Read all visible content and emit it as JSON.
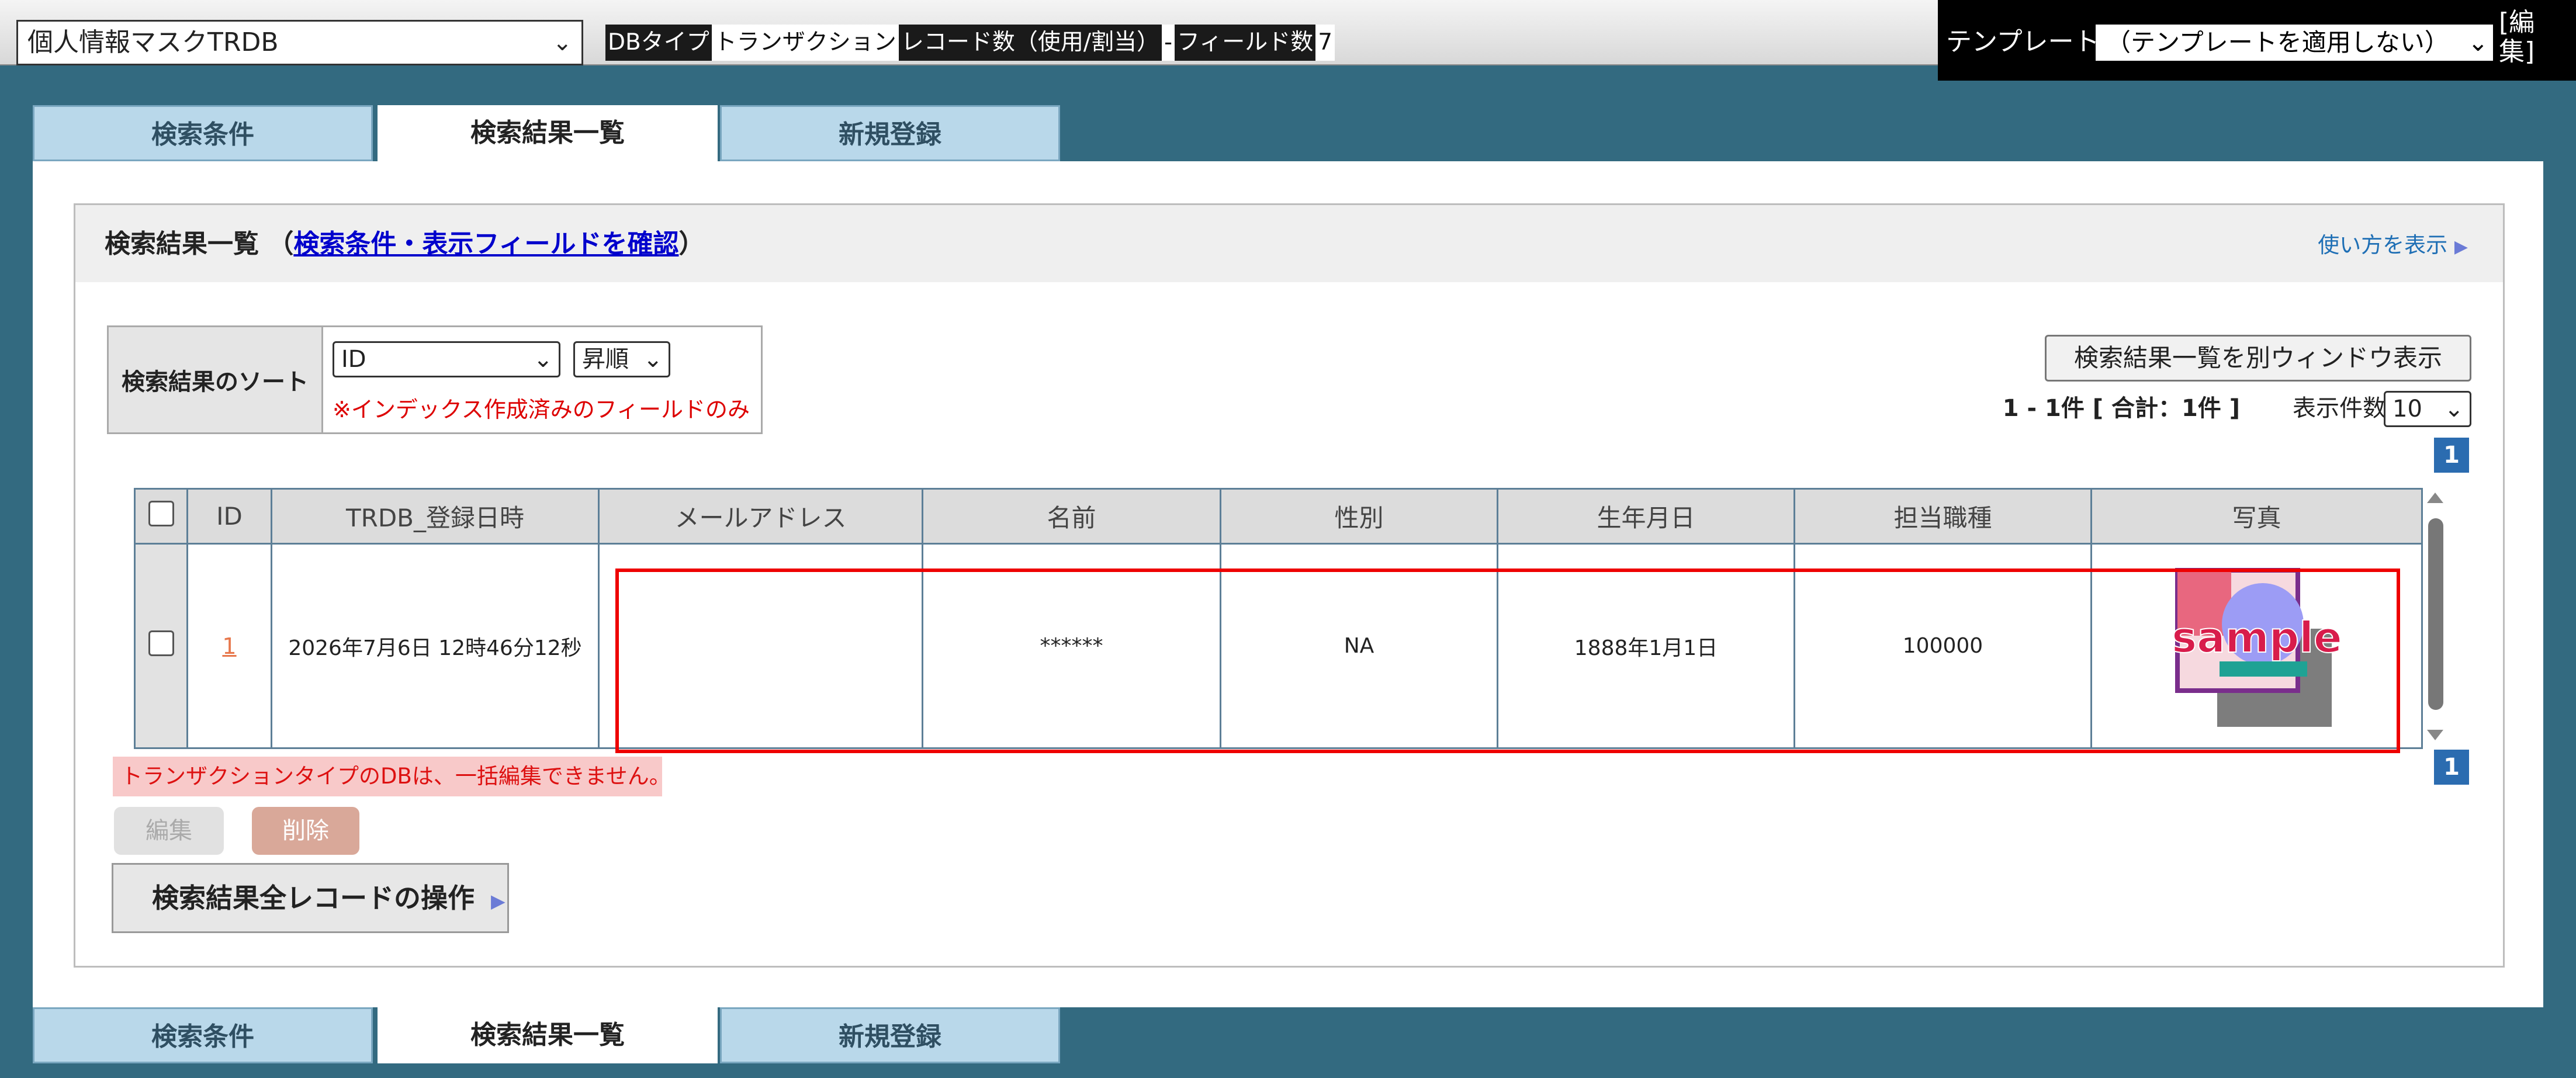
{
  "header": {
    "db_select_value": "個人情報マスクTRDB",
    "info": [
      {
        "text": "DBタイプ",
        "style": "dk"
      },
      {
        "text": "トランザクション",
        "style": "lt"
      },
      {
        "text": "レコード数（使用/割当）",
        "style": "dk"
      },
      {
        "text": "-",
        "style": "lt"
      },
      {
        "text": "フィールド数",
        "style": "dk"
      },
      {
        "text": "7",
        "style": "lt"
      }
    ],
    "template_label": "テンプレート",
    "template_value": "（テンプレートを適用しない）",
    "template_edit": "[編集]"
  },
  "tabs": [
    {
      "label": "検索条件",
      "active": false
    },
    {
      "label": "検索結果一覧",
      "active": true
    },
    {
      "label": "新規登録",
      "active": false
    }
  ],
  "content": {
    "title_prefix": "検索結果一覧 （",
    "title_link": "検索条件・表示フィールドを確認",
    "title_suffix": "）",
    "howto": "使い方を表示",
    "sort_label": "検索結果のソート",
    "sort_field": "ID",
    "sort_order": "昇順",
    "sort_note": "※インデックス作成済みのフィールドのみ",
    "open_window": "検索結果一覧を別ウィンドウ表示",
    "count_text": "1 - 1件 [ 合計：1件 ]",
    "perpage_label": "表示件数",
    "perpage_value": "10",
    "page_number": "1"
  },
  "table": {
    "columns": [
      "ID",
      "TRDB_登録日時",
      "メールアドレス",
      "名前",
      "性別",
      "生年月日",
      "担当職種",
      "写真"
    ],
    "rows": [
      {
        "id": "1",
        "registered": "2026年7月6日 12時46分12秒",
        "email": "",
        "name": "******",
        "gender": "NA",
        "birthday": "1888年1月1日",
        "job": "100000",
        "photo_text": "sample"
      }
    ]
  },
  "footer": {
    "warning": "トランザクションタイプのDBは、一括編集できません。",
    "edit_label": "編集",
    "delete_label": "削除",
    "all_ops_label": "検索結果全レコードの操作"
  },
  "colors": {
    "accent": "#336a80",
    "tab_inactive": "#b9d8ea",
    "page_badge": "#2b6cb0",
    "warning_bg": "#f8c9c9"
  }
}
